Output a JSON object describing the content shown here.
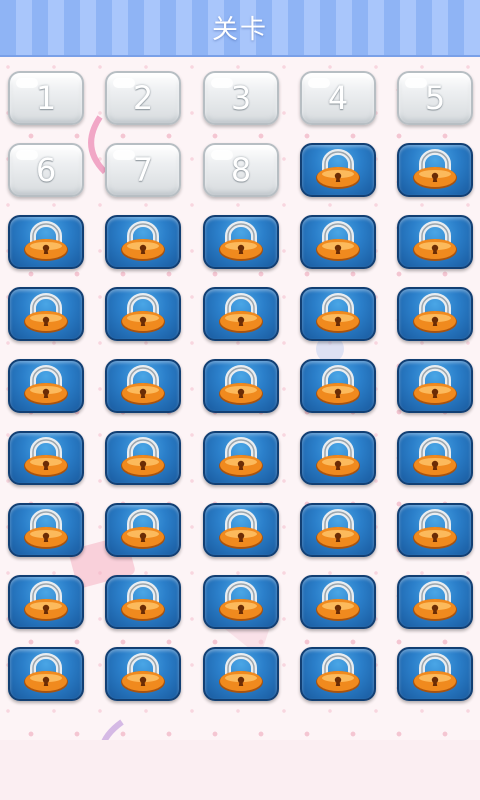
{
  "header": {
    "title": "关卡"
  },
  "levels": {
    "unlocked": [
      "1",
      "2",
      "3",
      "4",
      "5",
      "6",
      "7",
      "8"
    ],
    "locked_count": 37,
    "columns": 5
  },
  "colors": {
    "header_bg": "#8fb4f5",
    "unlocked_tile": "#e6e9eb",
    "locked_tile": "#2b7fca",
    "lock_body": "#f08a1e",
    "page_bg": "#fdf4f6"
  },
  "icons": {
    "locked": "padlock-icon"
  }
}
